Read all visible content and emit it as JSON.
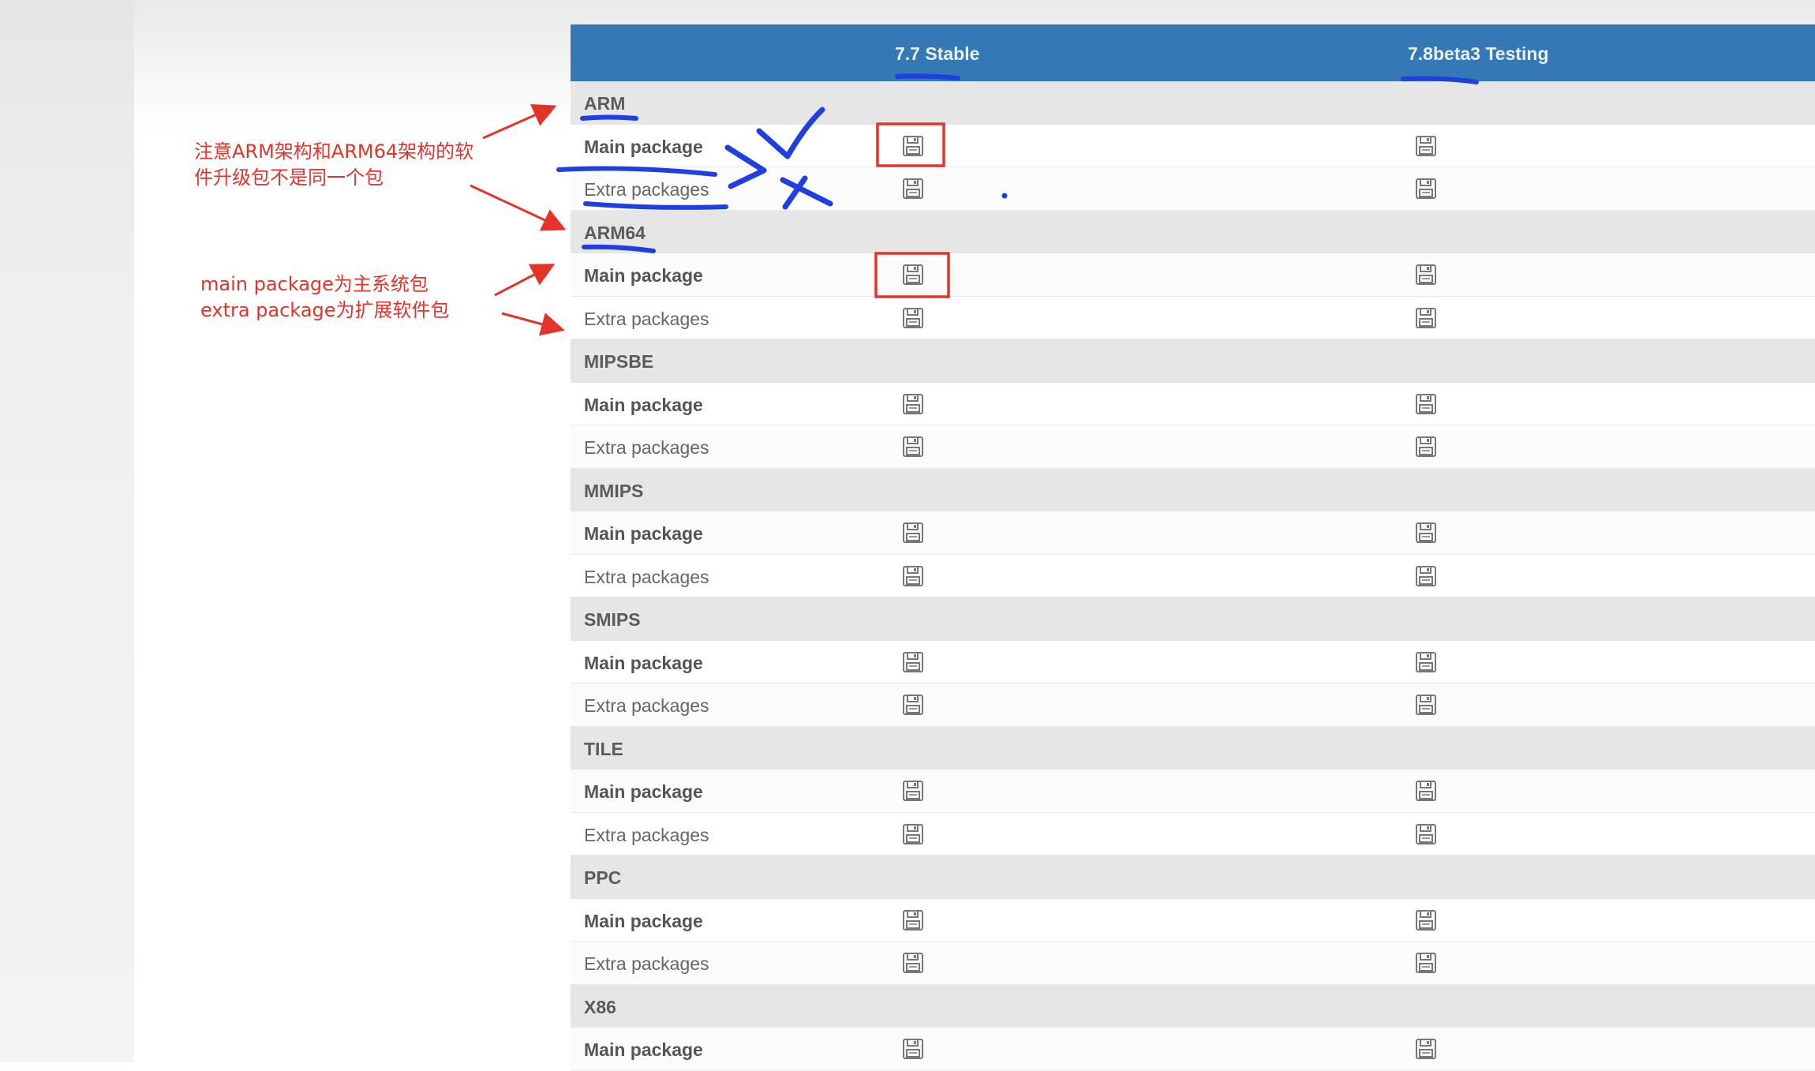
{
  "header": {
    "col_stable": "7.7 Stable",
    "col_testing": "7.8beta3 Testing"
  },
  "groups": [
    {
      "name": "ARM",
      "rows": [
        "Main package",
        "Extra packages"
      ]
    },
    {
      "name": "ARM64",
      "rows": [
        "Main package",
        "Extra packages"
      ]
    },
    {
      "name": "MIPSBE",
      "rows": [
        "Main package",
        "Extra packages"
      ]
    },
    {
      "name": "MMIPS",
      "rows": [
        "Main package",
        "Extra packages"
      ]
    },
    {
      "name": "SMIPS",
      "rows": [
        "Main package",
        "Extra packages"
      ]
    },
    {
      "name": "TILE",
      "rows": [
        "Main package",
        "Extra packages"
      ]
    },
    {
      "name": "PPC",
      "rows": [
        "Main package",
        "Extra packages"
      ]
    },
    {
      "name": "X86",
      "rows": [
        "Main package"
      ]
    }
  ],
  "icons": {
    "download": "floppy-disk-icon"
  },
  "annotations": {
    "note1": "注意ARM架构和ARM64架构的软件升级包不是同一个包",
    "note2_line1": "main package为主系统包",
    "note2_line2": "extra package为扩展软件包"
  },
  "colors": {
    "header_bg": "#3479b5",
    "group_bg": "#e6e6e6",
    "annotation_red": "#e5332a",
    "pen_blue": "#1f3fe0"
  }
}
